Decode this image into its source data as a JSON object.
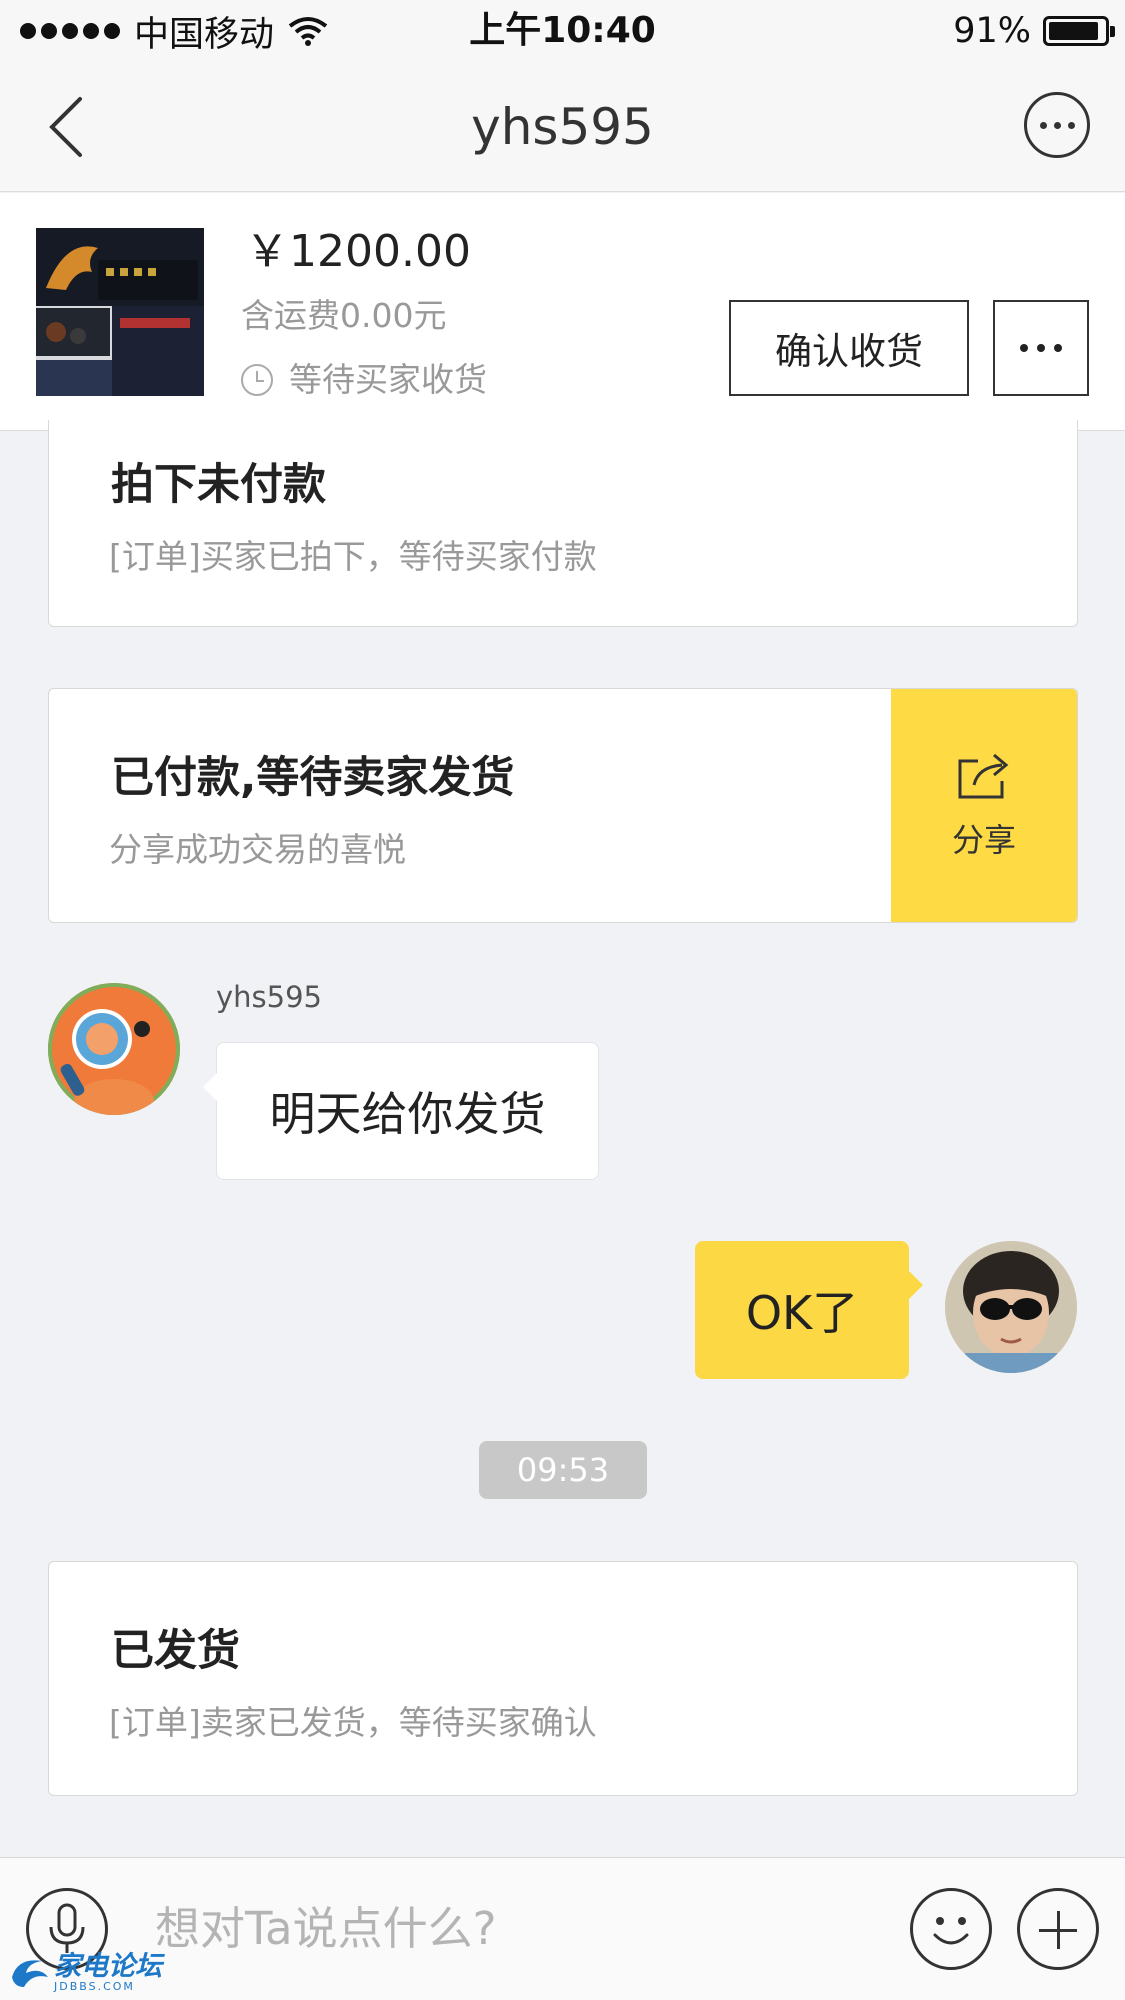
{
  "status_bar": {
    "carrier": "中国移动",
    "time": "上午10:40",
    "battery": "91%"
  },
  "nav": {
    "title": "yhs595"
  },
  "product": {
    "price": "￥1200.00",
    "shipping": "含运费0.00元",
    "status": "等待买家收货",
    "confirm_label": "确认收货"
  },
  "messages": {
    "unpaid": {
      "title": "拍下未付款",
      "subtitle": "[订单]买家已拍下，等待买家付款"
    },
    "paid": {
      "title": "已付款,等待卖家发货",
      "subtitle": "分享成功交易的喜悦",
      "share_label": "分享"
    },
    "seller_name": "yhs595",
    "seller_message": "明天给你发货",
    "buyer_message": "OK了",
    "timestamp": "09:53",
    "shipped": {
      "title": "已发货",
      "subtitle": "[订单]卖家已发货，等待买家确认"
    }
  },
  "input": {
    "placeholder": "想对Ta说点什么?"
  },
  "watermark": {
    "text": "家电论坛",
    "sub": "JDBBS.COM"
  },
  "colors": {
    "accent_yellow": "#fedb44",
    "background": "#f1f2f5"
  }
}
